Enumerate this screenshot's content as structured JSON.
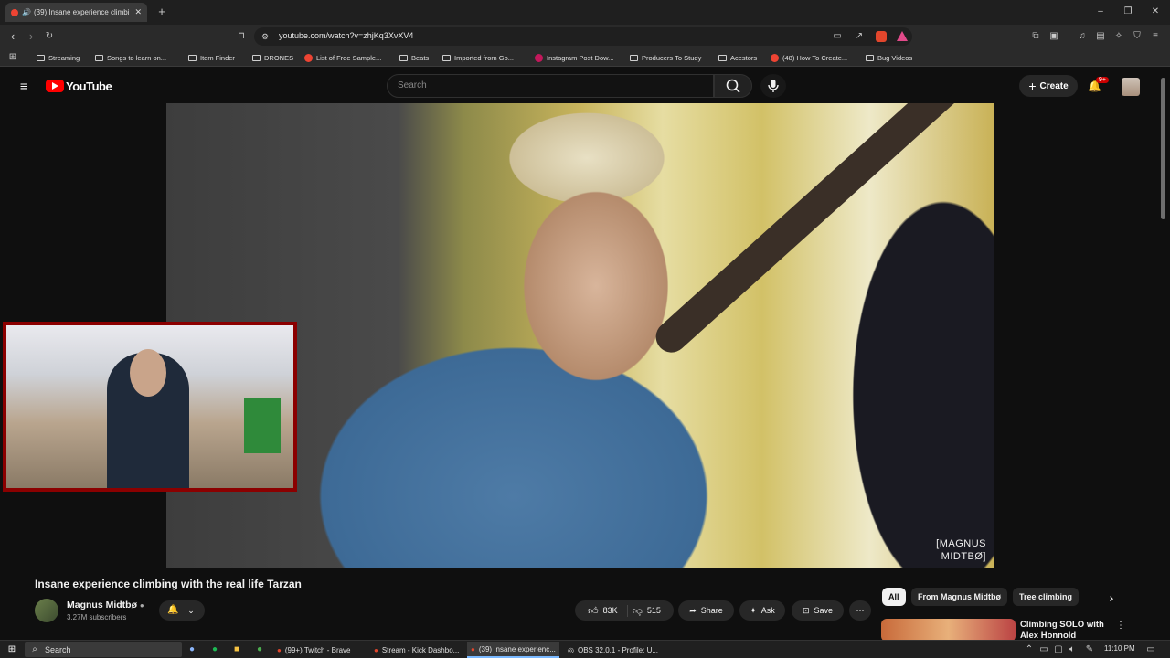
{
  "browser": {
    "tab_title": "(39) Insane experience climbi",
    "new_tab": "+",
    "url": "youtube.com/watch?v=zhjKq3XvXV4",
    "window_controls": [
      "–",
      "❐",
      "✕"
    ]
  },
  "bookmarks": [
    {
      "label": "Streaming",
      "icon": "folder-icon"
    },
    {
      "label": "Songs to learn on...",
      "icon": "folder-icon"
    },
    {
      "label": "Item Finder",
      "icon": "folder-icon"
    },
    {
      "label": "DRONES",
      "icon": "folder-icon"
    },
    {
      "label": "List of Free Sample...",
      "icon": "site-icon"
    },
    {
      "label": "Beats",
      "icon": "folder-icon"
    },
    {
      "label": "Imported from Go...",
      "icon": "folder-icon"
    },
    {
      "label": "Instagram Post Dow...",
      "icon": "site-icon"
    },
    {
      "label": "Producers To Study",
      "icon": "folder-icon"
    },
    {
      "label": "Acestors",
      "icon": "folder-icon"
    },
    {
      "label": "(48) How To Create...",
      "icon": "youtube-icon"
    },
    {
      "label": "Bug Videos",
      "icon": "folder-icon"
    }
  ],
  "youtube": {
    "logo": "YouTube",
    "search_placeholder": "Search",
    "create_label": "Create",
    "notification_count": "9+"
  },
  "video": {
    "watermark_line1": "[MAGNUS",
    "watermark_line2": "MIDTBØ]",
    "title": "Insane experience climbing with the real life Tarzan",
    "channel": "Magnus Midtbø",
    "subscribers": "3.27M subscribers",
    "likes": "83K",
    "dislikes": "515",
    "share": "Share",
    "ask": "Ask",
    "save": "Save"
  },
  "chips": [
    "All",
    "From Magnus Midtbø",
    "Tree climbing"
  ],
  "recommendation": {
    "title": "Climbing SOLO with Alex Honnold"
  },
  "taskbar": {
    "search": "Search",
    "tasks": [
      {
        "label": "(99+) Twitch - Brave",
        "active": false
      },
      {
        "label": "Stream - Kick Dashbo...",
        "active": false
      },
      {
        "label": "(39) Insane experienc...",
        "active": true
      },
      {
        "label": "OBS 32.0.1 - Profile: U...",
        "active": false
      }
    ],
    "time": "11:10 PM"
  }
}
